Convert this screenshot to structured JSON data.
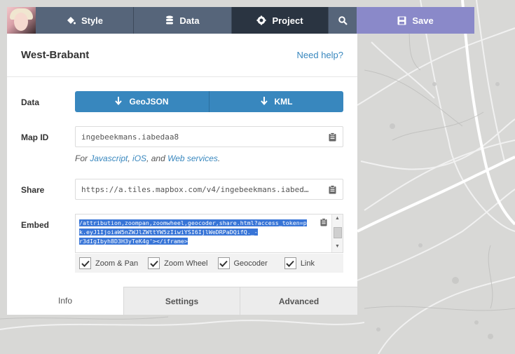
{
  "toolbar": {
    "style_label": "Style",
    "data_label": "Data",
    "project_label": "Project",
    "save_label": "Save",
    "colors": {
      "tab": "#56657a",
      "active_tab": "#2a3441",
      "save": "#8a89c9"
    }
  },
  "panel": {
    "title": "West-Brabant",
    "help_link": "Need help?"
  },
  "data_row": {
    "label": "Data",
    "geojson_label": "GeoJSON",
    "kml_label": "KML",
    "button_color": "#3887be"
  },
  "mapid_row": {
    "label": "Map ID",
    "value": "ingebeekmans.iabedaa8",
    "for_prefix": "For ",
    "link_js": "Javascript",
    "sep1": ", ",
    "link_ios": "iOS",
    "sep2": ", and ",
    "link_web": "Web services",
    "suffix": "."
  },
  "share_row": {
    "label": "Share",
    "value": "https://a.tiles.mapbox.com/v4/ingebeekmans.iabed…"
  },
  "embed_row": {
    "label": "Embed",
    "line1": "/attribution,zoompan,zoomwheel,geocoder,share.html?access_token=p",
    "line2": "k.eyJ1IjoiaW5nZWJlZWttYW5zIiwiYSI6IjlWeDRPaDQifQ._-",
    "line3": "r3dIgIbyh8D3H3yTeK4g'></iframe>"
  },
  "options": [
    {
      "label": "Zoom & Pan",
      "checked": true
    },
    {
      "label": "Zoom Wheel",
      "checked": true
    },
    {
      "label": "Geocoder",
      "checked": true
    },
    {
      "label": "Link",
      "checked": true
    }
  ],
  "bottom_tabs": {
    "info": "Info",
    "settings": "Settings",
    "advanced": "Advanced"
  }
}
